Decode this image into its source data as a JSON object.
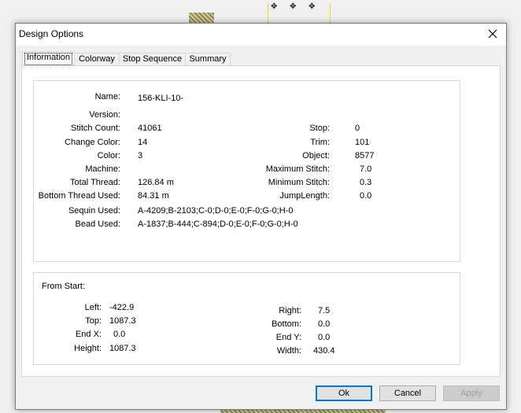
{
  "window": {
    "title": "Design Options",
    "close_glyph": "close-icon"
  },
  "tabs": [
    {
      "label": "Information",
      "active": true
    },
    {
      "label": "Colorway",
      "active": false
    },
    {
      "label": "Stop Sequence",
      "active": false
    },
    {
      "label": "Summary",
      "active": false
    }
  ],
  "info": {
    "name_label": "Name:",
    "name_value": "156-KLI-10-",
    "version_label": "Version:",
    "version_value": "",
    "stitch_count_label": "Stitch Count:",
    "stitch_count_value": "41061",
    "change_color_label": "Change Color:",
    "change_color_value": "14",
    "color_label": "Color:",
    "color_value": "3",
    "machine_label": "Machine:",
    "machine_value": "",
    "total_thread_label": "Total Thread:",
    "total_thread_value": "126.84 m",
    "bottom_thread_label": "Bottom Thread Used:",
    "bottom_thread_value": "84.31 m",
    "sequin_label": "Sequin Used:",
    "sequin_value": "A-4209;B-2103;C-0;D-0;E-0;F-0;G-0;H-0",
    "bead_label": "Bead Used:",
    "bead_value": "A-1837;B-444;C-894;D-0;E-0;F-0;G-0;H-0",
    "stop_label": "Stop:",
    "stop_value": "0",
    "trim_label": "Trim:",
    "trim_value": "101",
    "object_label": "Object:",
    "object_value": "8577",
    "max_stitch_label": "Maximum Stitch:",
    "max_stitch_value": "7.0",
    "min_stitch_label": "Minimum Stitch:",
    "min_stitch_value": "0.3",
    "jump_length_label": "JumpLength:",
    "jump_length_value": "0.0"
  },
  "from_start": {
    "heading": "From Start:",
    "left_label": "Left:",
    "left_value": "-422.9",
    "top_label": "Top:",
    "top_value": "1087.3",
    "endx_label": "End X:",
    "endx_value": "0.0",
    "height_label": "Height:",
    "height_value": "1087.3",
    "right_label": "Right:",
    "right_value": "7.5",
    "bottom_label": "Bottom:",
    "bottom_value": "0.0",
    "endy_label": "End Y:",
    "endy_value": "0.0",
    "width_label": "Width:",
    "width_value": "430.4"
  },
  "buttons": {
    "ok": "Ok",
    "cancel": "Cancel",
    "apply": "Apply"
  },
  "colors": {
    "dialog_bg": "#f0f0f0",
    "focus_blue": "#0078d7",
    "disabled_text": "#a0a0a0"
  }
}
